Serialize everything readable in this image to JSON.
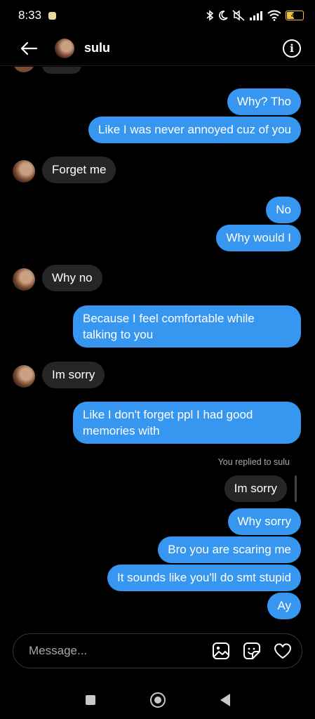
{
  "status_bar": {
    "time": "8:33",
    "battery": "43",
    "icons": [
      "notification-icon",
      "bluetooth-icon",
      "dnd-moon-icon",
      "muted-icon",
      "signal-icon",
      "wifi-icon",
      "battery-icon"
    ]
  },
  "header": {
    "title": "sulu",
    "back_icon": "arrow-left-icon",
    "info_icon": "info-icon",
    "info_glyph": "i"
  },
  "messages": [
    {
      "side": "out",
      "text": "Why? Tho"
    },
    {
      "side": "out",
      "text": "Like I was never annoyed cuz of you"
    },
    {
      "side": "in",
      "text": "Forget me"
    },
    {
      "side": "out",
      "text": "No"
    },
    {
      "side": "out",
      "text": "Why would I"
    },
    {
      "side": "in",
      "text": "Why no"
    },
    {
      "side": "out",
      "text": "Because I feel comfortable while talking to you"
    },
    {
      "side": "in",
      "text": "Im sorry"
    },
    {
      "side": "out",
      "text": "Like I don't forget ppl I had good memories with"
    },
    {
      "side": "in",
      "text": "Im sorry"
    },
    {
      "side": "out",
      "text": "Why sorry"
    },
    {
      "side": "out",
      "text": "Bro you are scaring me"
    },
    {
      "side": "out",
      "text": "It sounds like you'll do smt stupid"
    },
    {
      "side": "out",
      "text": "Ay"
    }
  ],
  "reply_note": "You replied to sulu",
  "composer": {
    "placeholder": "Message...",
    "icons": [
      "gallery-icon",
      "sticker-icon",
      "heart-icon"
    ]
  },
  "nav": [
    "recents-icon",
    "home-icon",
    "back-icon"
  ]
}
